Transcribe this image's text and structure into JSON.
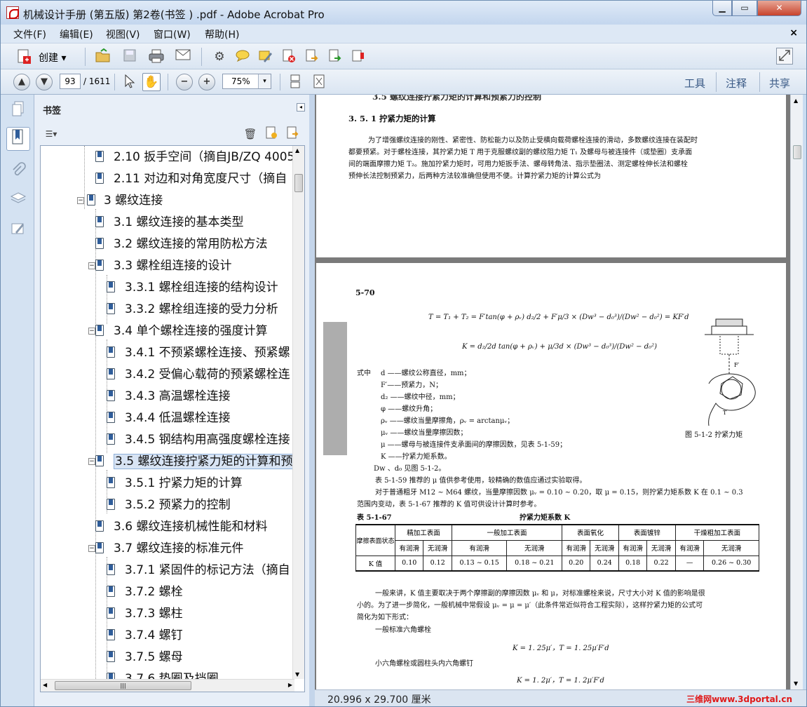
{
  "window": {
    "title": "机械设计手册 (第五版) 第2卷(书签 ) .pdf - Adobe Acrobat Pro",
    "min": "▁",
    "max": "▭",
    "close": "✕"
  },
  "menu": {
    "items": [
      "文件(F)",
      "编辑(E)",
      "视图(V)",
      "窗口(W)",
      "帮助(H)"
    ],
    "close": "×"
  },
  "toolbar": {
    "create_label": "创建",
    "create_arrow": "▾"
  },
  "nav": {
    "page_current": "93",
    "page_total": "/ 1611",
    "zoom": "75%",
    "zoom_arrow": "▾",
    "tools": "工具",
    "comment": "注释",
    "share": "共享"
  },
  "bookmarks": {
    "title": "书签",
    "items": [
      {
        "label": "2.10 扳手空间（摘自JB/ZQ 4005"
      },
      {
        "label": "2.11 对边和对角宽度尺寸（摘自"
      },
      {
        "label": "3 螺纹连接"
      },
      {
        "label": "3.1 螺纹连接的基本类型"
      },
      {
        "label": "3.2 螺纹连接的常用防松方法"
      },
      {
        "label": "3.3 螺栓组连接的设计"
      },
      {
        "label": "3.3.1 螺栓组连接的结构设计"
      },
      {
        "label": "3.3.2 螺栓组连接的受力分析"
      },
      {
        "label": "3.4 单个螺栓连接的强度计算"
      },
      {
        "label": "3.4.1 不预紧螺栓连接、预紧螺"
      },
      {
        "label": "3.4.2 受偏心载荷的预紧螺栓连"
      },
      {
        "label": "3.4.3 高温螺栓连接"
      },
      {
        "label": "3.4.4 低温螺栓连接"
      },
      {
        "label": "3.4.5 钢结构用高强度螺栓连接"
      },
      {
        "label": "3.5 螺纹连接拧紧力矩的计算和预"
      },
      {
        "label": "3.5.1 拧紧力矩的计算"
      },
      {
        "label": "3.5.2 预紧力的控制"
      },
      {
        "label": "3.6 螺纹连接机械性能和材料"
      },
      {
        "label": "3.7 螺纹连接的标准元件"
      },
      {
        "label": "3.7.1 紧固件的标记方法（摘自"
      },
      {
        "label": "3.7.2 螺栓"
      },
      {
        "label": "3.7.3 螺柱"
      },
      {
        "label": "3.7.4 螺钉"
      },
      {
        "label": "3.7.5 螺母"
      },
      {
        "label": "3.7.6 垫圈及挡圈"
      }
    ]
  },
  "document": {
    "top_header": "3.5 螺纹连接拧紧力矩的计算和预紧力的控制",
    "section_title": "3. 5. 1   拧紧力矩的计算",
    "para1": [
      "为了增强螺纹连接的刚性、紧密性、防松能力以及防止受横向载荷螺栓连接的滑动，多数螺纹连接在装配时",
      "都要预紧。对于螺栓连接，其拧紧力矩 T 用于克服螺纹副的螺纹阻力矩 T₁ 及螺母与被连接件（或垫圈）支承面",
      "间的端面摩擦力矩 T₂。施加拧紧力矩时，可用力矩扳手法、螺母转角法、指示垫圈法、测定螺栓伸长法和螺栓",
      "预伸长法控制预紧力，后两种方法较准确但使用不便。计算拧紧力矩的计算公式为"
    ],
    "page_number": "5-70",
    "formula1": "T = T₁ + T₂ = F′tan(φ + ρᵥ) d₂/2 + F′μ/3 × (Dw³ − d₀³)/(Dw² − d₀²) = KF′d",
    "formula2": "K = d₂/2d tan(φ + ρᵥ) + μ/3d × (Dw³ − d₀³)/(Dw² − d₀²)",
    "where_label": "式中",
    "definitions": [
      "d ——螺纹公称直径，mm；",
      "F′——预紧力，N；",
      "d₂ ——螺纹中径，mm；",
      "φ ——螺纹升角；",
      "ρᵥ ——螺纹当量摩擦角，ρᵥ = arctanμᵥ；",
      "μᵥ ——螺纹当量摩擦因数；",
      "μ ——螺母与被连接件支承面间的摩擦因数，见表 5-1-59；",
      "K ——拧紧力矩系数。",
      "Dw 、d₀ 见图 5-1-2。"
    ],
    "figure_caption": "图 5-1-2   拧紧力矩",
    "para2": [
      "表 5-1-59 推荐的 μ 值供参考使用，较精确的数值应通过实验取得。",
      "对于普通粗牙 M12 ~ M64 螺纹，当量摩擦因数 μᵥ = 0.10 ~ 0.20，取 μ = 0.15，则拧紧力矩系数 K 在 0.1 ~ 0.3",
      "范围内变动，表 5-1-67 推荐的 K 值可供设计计算时参考。"
    ],
    "table_id": "表 5-1-67",
    "table_title": "拧紧力矩系数 K",
    "table": {
      "corner": "摩擦表面状态",
      "groups": [
        "精加工表面",
        "一般加工表面",
        "表面氧化",
        "表面镀锌",
        "干燥粗加工表面"
      ],
      "sub": [
        "有润滑",
        "无润滑",
        "有润滑",
        "无润滑",
        "有润滑",
        "无润滑",
        "有润滑",
        "无润滑",
        "有润滑",
        "无润滑"
      ],
      "row_label": "K 值",
      "values": [
        "0.10",
        "0.12",
        "0.13 ~ 0.15",
        "0.18 ~ 0.21",
        "0.20",
        "0.24",
        "0.18",
        "0.22",
        "—",
        "0.26 ~ 0.30"
      ]
    },
    "para3": [
      "一般来讲，K 值主要取决于两个摩擦副的摩擦因数 μᵥ 和 μ，对标准螺栓来说，尺寸大小对 K 值的影响是很",
      "小的。为了进一步简化，一般机械中常假设 μᵥ = μ = μ′（此条件常近似符合工程实际），这样拧紧力矩的公式可",
      "简化为如下形式："
    ],
    "case1": "一般标准六角螺栓",
    "formula3": "K = 1. 25μ′，T = 1. 25μ′F′d",
    "case2": "小六角螺栓或圆柱头内六角螺钉",
    "formula4": "K = 1. 2μ′，T = 1. 2μ′F′d"
  },
  "status": {
    "size": "20.996 x 29.700 厘米",
    "watermark": "三维网www.3dportal.cn"
  }
}
